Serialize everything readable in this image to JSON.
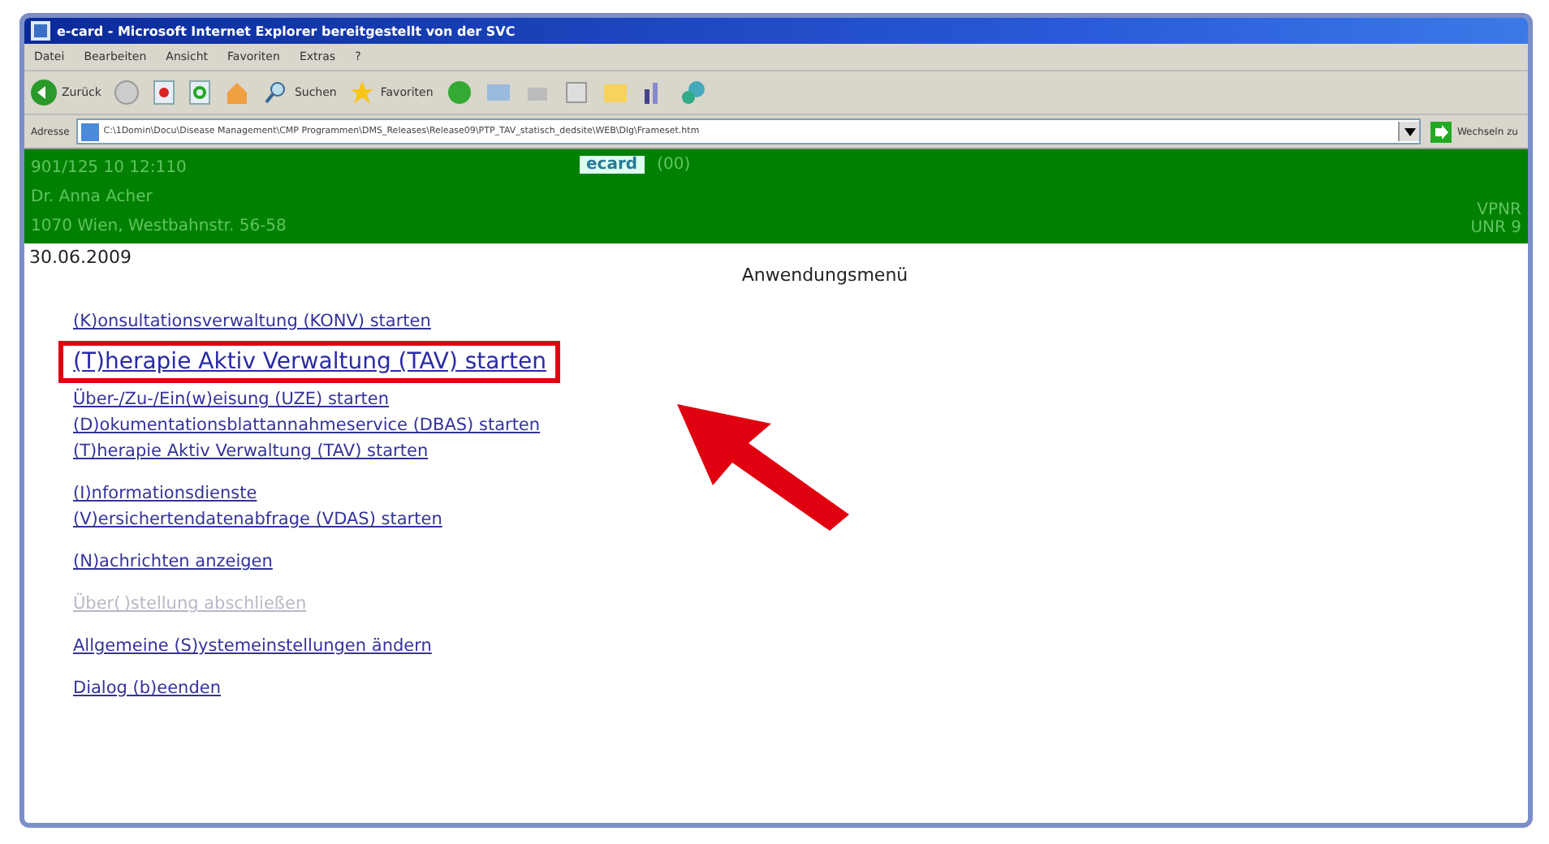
{
  "window": {
    "title": "e-card - Microsoft Internet Explorer bereitgestellt von der SVC"
  },
  "menu": [
    "Datei",
    "Bearbeiten",
    "Ansicht",
    "Favoriten",
    "Extras",
    "?"
  ],
  "toolbar": {
    "back": "Zurück",
    "search": "Suchen",
    "favorites": "Favoriten"
  },
  "address": {
    "label": "Adresse",
    "value": "C:\\1Domin\\Docu\\Disease Management\\CMP Programmen\\DMS_Releases\\Release09\\PTP_TAV_statisch_dedsite\\WEB\\Dlg\\Frameset.htm",
    "go": "Wechseln zu"
  },
  "header": {
    "left": [
      "901/125 10 12:110",
      "Dr. Anna Acher",
      "1070 Wien, Westbahnstr. 56-58"
    ],
    "logo": "ecard",
    "code": "(00)",
    "right": [
      "VPNR",
      "UNR 9"
    ]
  },
  "date": "30.06.2009",
  "page_title": "Anwendungsmenü",
  "link_groups": [
    [
      {
        "text": "(K)onsultationsverwaltung (KONV) starten",
        "disabled": false,
        "highlighted": false
      },
      {
        "text": "(T)herapie Aktiv Verwaltung (TAV) starten",
        "disabled": false,
        "highlighted": true
      },
      {
        "text": "Über-/Zu-/Ein(w)eisung (UZE) starten",
        "disabled": false,
        "highlighted": false
      },
      {
        "text": "(D)okumentationsblattannahmeservice (DBAS) starten",
        "disabled": false,
        "highlighted": false
      },
      {
        "text": "(T)herapie Aktiv Verwaltung (TAV) starten",
        "disabled": false,
        "highlighted": false
      }
    ],
    [
      {
        "text": "(I)nformationsdienste",
        "disabled": false,
        "highlighted": false
      },
      {
        "text": "(V)ersichertendatenabfrage (VDAS) starten",
        "disabled": false,
        "highlighted": false
      }
    ],
    [
      {
        "text": "(N)achrichten anzeigen",
        "disabled": false,
        "highlighted": false
      }
    ],
    [
      {
        "text": "Über( )stellung abschließen",
        "disabled": true,
        "highlighted": false
      }
    ],
    [
      {
        "text": "Allgemeine (S)ystemeinstellungen ändern",
        "disabled": false,
        "highlighted": false
      }
    ],
    [
      {
        "text": "Dialog (b)eenden",
        "disabled": false,
        "highlighted": false
      }
    ]
  ]
}
